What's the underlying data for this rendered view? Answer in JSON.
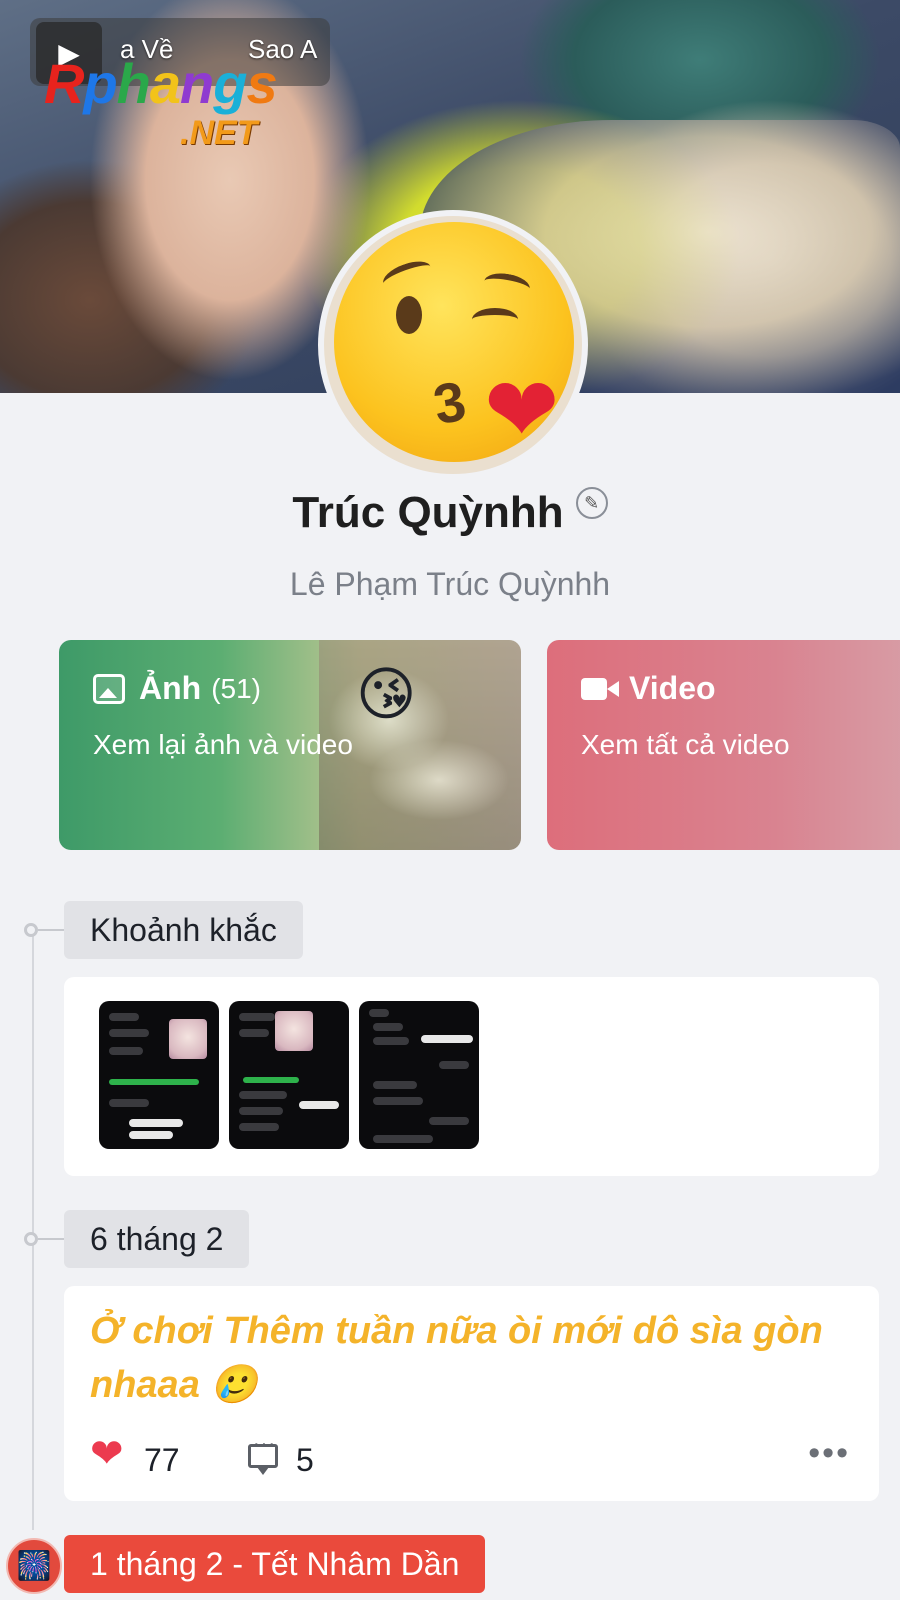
{
  "cover": {
    "link_back": "a Về",
    "link_star": "Sao A",
    "watermark_main": "Rphangs",
    "watermark_sub": ".NET"
  },
  "avatar": {
    "emoji": "kissing-face-with-heart"
  },
  "profile": {
    "display_name": "Trúc Quỳnhh",
    "full_name": "Lê Phạm Trúc Quỳnhh"
  },
  "media": {
    "photos": {
      "title": "Ảnh",
      "count": "(51)",
      "subtitle": "Xem lại ảnh và video",
      "emoji": "😘"
    },
    "videos": {
      "title": "Video",
      "subtitle": "Xem tất cả video"
    }
  },
  "timeline": {
    "moments_label": "Khoảnh khắc",
    "moments_thumbnails": 3,
    "post_date": "6 tháng 2",
    "post": {
      "text": "Ở chơi Thêm tuần nữa òi mới dô sìa gòn nhaaa 🥲",
      "likes": "77",
      "comments": "5",
      "more": "•••"
    },
    "event_label": "1 tháng 2 - Tết Nhâm Dần",
    "event_icon": "🎆"
  },
  "colors": {
    "photos_card": "#3e9a68",
    "videos_card": "#dd6e7b",
    "post_text": "#f4b32a",
    "like_heart": "#ec3a4f",
    "event_label": "#ea4a3c"
  }
}
